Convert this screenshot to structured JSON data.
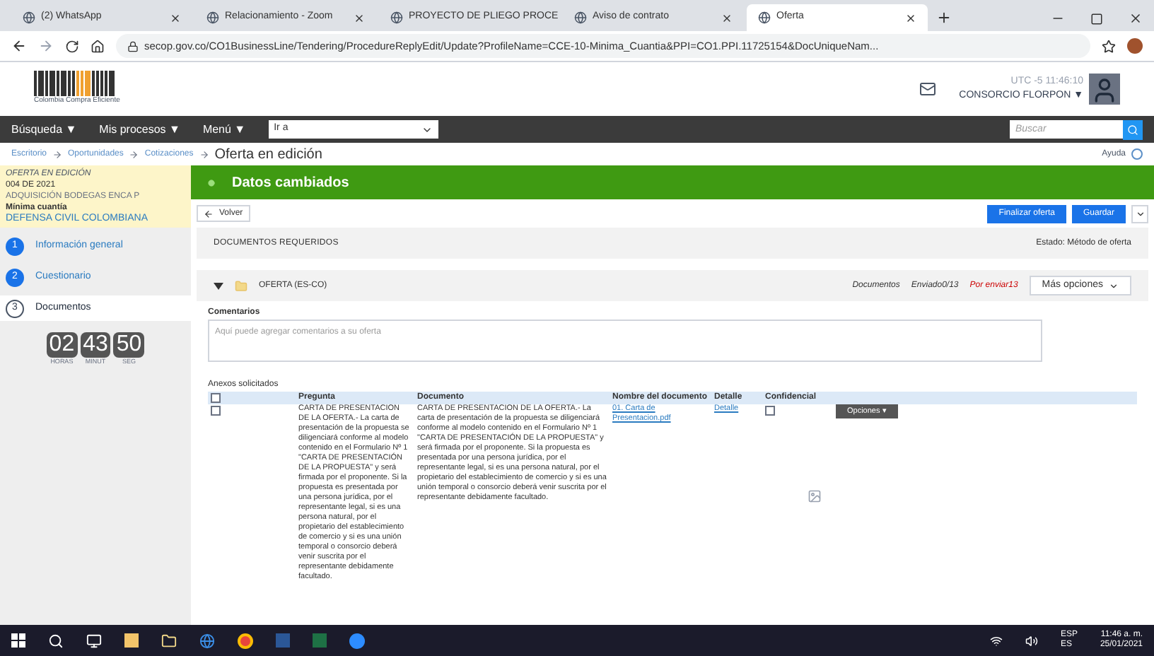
{
  "browser": {
    "tabs": [
      {
        "title": "(2) WhatsApp",
        "selected": false
      },
      {
        "title": "Relacionamiento - Zoom",
        "selected": false
      },
      {
        "title": "PROYECTO DE PLIEGO PROCE",
        "selected": false
      },
      {
        "title": "Aviso de contrato",
        "selected": false
      },
      {
        "title": "Oferta",
        "selected": true
      }
    ],
    "url": "secop.gov.co/CO1BusinessLine/Tendering/ProcedureReplyEdit/Update?ProfileName=CCE-10-Minima_Cuantia&PPI=CO1.PPI.11725154&DocUniqueNam..."
  },
  "header": {
    "logo_text": "Colombia Compra Eficiente",
    "clock": "UTC -5 11:46:10",
    "user": "CONSORCIO FLORPON ▼"
  },
  "nav": {
    "menus": [
      "Búsqueda ▼",
      "Mis procesos ▼",
      "Menú ▼"
    ],
    "goto": "Ir a",
    "search_placeholder": "Buscar"
  },
  "breadcrumbs": {
    "items": [
      "Escritorio",
      "Oportunidades",
      "Cotizaciones"
    ],
    "current": "Oferta en edición",
    "help": "Ayuda"
  },
  "sidebar": {
    "status": "OFERTA EN EDICIÓN",
    "number": "004 DE 2021",
    "title": "ADQUISICIÓN BODEGAS ENCA P",
    "modality": "Mínima cuantía",
    "entity": "DEFENSA CIVIL COLOMBIANA",
    "steps": [
      {
        "number": "1",
        "label": "Información general",
        "selected": false
      },
      {
        "number": "2",
        "label": "Cuestionario",
        "selected": false
      },
      {
        "number": "3",
        "label": "Documentos",
        "selected": true
      }
    ],
    "timer": [
      {
        "value": "02",
        "unit": "HORAS"
      },
      {
        "value": "43",
        "unit": "MINUT"
      },
      {
        "value": "50",
        "unit": "SEG"
      }
    ]
  },
  "banner": "Datos cambiados",
  "back_button": "Volver",
  "actions": [
    "Finalizar oferta",
    "Guardar"
  ],
  "section": {
    "title": "DOCUMENTOS REQUERIDOS",
    "status": "Estado: Método de oferta"
  },
  "folder": {
    "name": "OFERTA (ES-CO)",
    "documents": "Documentos",
    "sent": "Enviado0/13",
    "pending": "Por enviar13",
    "more": "Más opciones"
  },
  "comments": {
    "label": "Comentarios",
    "placeholder": "Aquí puede agregar comentarios a su oferta"
  },
  "annexes": {
    "title": "Anexos solicitados",
    "all_checked": false,
    "columns": [
      "Pregunta",
      "Documento",
      "Nombre del documento",
      "Detalle",
      "Confidencial"
    ],
    "rows": [
      {
        "checked": false,
        "question": "CARTA DE PRESENTACION DE LA OFERTA.- La carta de presentación de la propuesta se diligenciará conforme al modelo contenido en el Formulario Nº 1 \"CARTA DE PRESENTACIÓN DE LA PROPUESTA\" y será firmada por el proponente. Si la propuesta es presentada por una persona jurídica, por el representante legal, si es una persona natural, por el propietario del establecimiento de comercio y si es una unión temporal o consorcio deberá venir suscrita por el representante debidamente facultado.",
        "document": "CARTA DE PRESENTACION DE LA OFERTA.- La carta de presentación de la propuesta se diligenciará conforme al modelo contenido en el Formulario Nº 1 \"CARTA DE PRESENTACIÓN DE LA PROPUESTA\" y será firmada por el proponente. Si la propuesta es presentada por una persona jurídica, por el representante legal, si es una persona natural, por el propietario del establecimiento de comercio y si es una unión temporal o consorcio deberá venir suscrita por el representante debidamente facultado.",
        "file": "01. Carta de Presentacion.pdf",
        "detail": "Detalle",
        "confidential": false,
        "options": "Opciones ▾"
      }
    ]
  },
  "taskbar": {
    "lang": "ESP",
    "region": "ES",
    "time": "11:46 a. m.",
    "date": "25/01/2021"
  }
}
